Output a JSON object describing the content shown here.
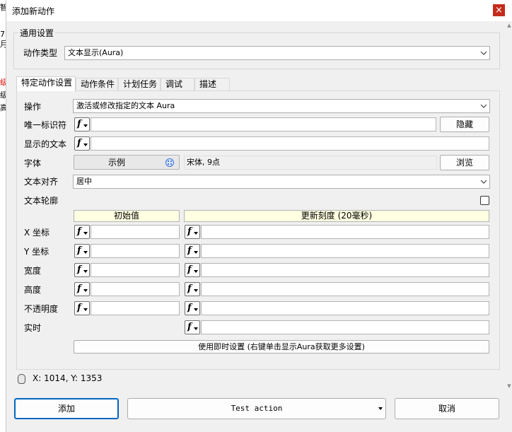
{
  "background": {
    "fragments": [
      "智",
      "7",
      "月",
      "级",
      "级",
      "高"
    ]
  },
  "window": {
    "title": "添加新动作",
    "close_label": "×"
  },
  "general": {
    "legend": "通用设置",
    "action_type_label": "动作类型",
    "action_type_value": "文本显示(Aura)"
  },
  "tabs": [
    {
      "label": "特定动作设置",
      "active": true
    },
    {
      "label": "动作条件",
      "active": false
    },
    {
      "label": "计划任务",
      "active": false
    },
    {
      "label": "调试",
      "active": false
    },
    {
      "label": "描述",
      "active": false
    }
  ],
  "form": {
    "operation_label": "操作",
    "operation_value": "激活或修改指定的文本 Aura",
    "uid_label": "唯一标识符",
    "uid_value": "",
    "hide_button": "隐藏",
    "display_text_label": "显示的文本",
    "display_text_value": "",
    "font_label": "字体",
    "font_sample": "示例",
    "font_desc": "宋体, 9点",
    "browse_button": "浏览",
    "align_label": "文本对齐",
    "align_value": "居中",
    "outline_label": "文本轮廓",
    "outline_checked": false,
    "col_initial": "初始值",
    "col_update": "更新刻度 (20毫秒)",
    "rows": [
      {
        "label": "X 坐标"
      },
      {
        "label": "Y 坐标"
      },
      {
        "label": "宽度"
      },
      {
        "label": "高度"
      },
      {
        "label": "不透明度"
      }
    ],
    "realtime_label": "实时",
    "live_settings_button": "使用即时设置 (右键单击显示Aura获取更多设置)"
  },
  "status": {
    "coords": "X: 1014, Y: 1353"
  },
  "buttons": {
    "add": "添加",
    "test": "Test action",
    "cancel": "取消"
  },
  "f_icon_glyph": "f",
  "colors": {
    "accent": "#0067c0",
    "close": "#c42b1c",
    "header_cell": "#ffffe1"
  }
}
